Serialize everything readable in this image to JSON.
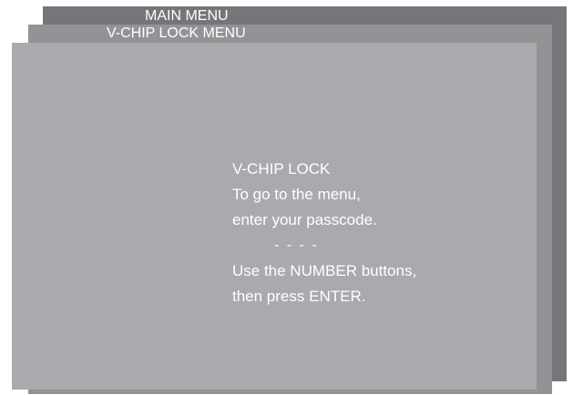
{
  "main_menu": {
    "title": "MAIN MENU"
  },
  "vchip_menu": {
    "title": "V-CHIP LOCK MENU"
  },
  "vchip_lock": {
    "heading": "V-CHIP LOCK",
    "instruction_line1": "To go to the menu,",
    "instruction_line2": "enter your passcode.",
    "passcode_placeholder": "- - - -",
    "hint_line1": "Use the NUMBER buttons,",
    "hint_line2": "then press ENTER."
  },
  "colors": {
    "main_menu_panel": "#76767a",
    "vchip_menu_panel": "#939396",
    "lock_panel": "#a9aaad",
    "text": "#ffffff"
  }
}
